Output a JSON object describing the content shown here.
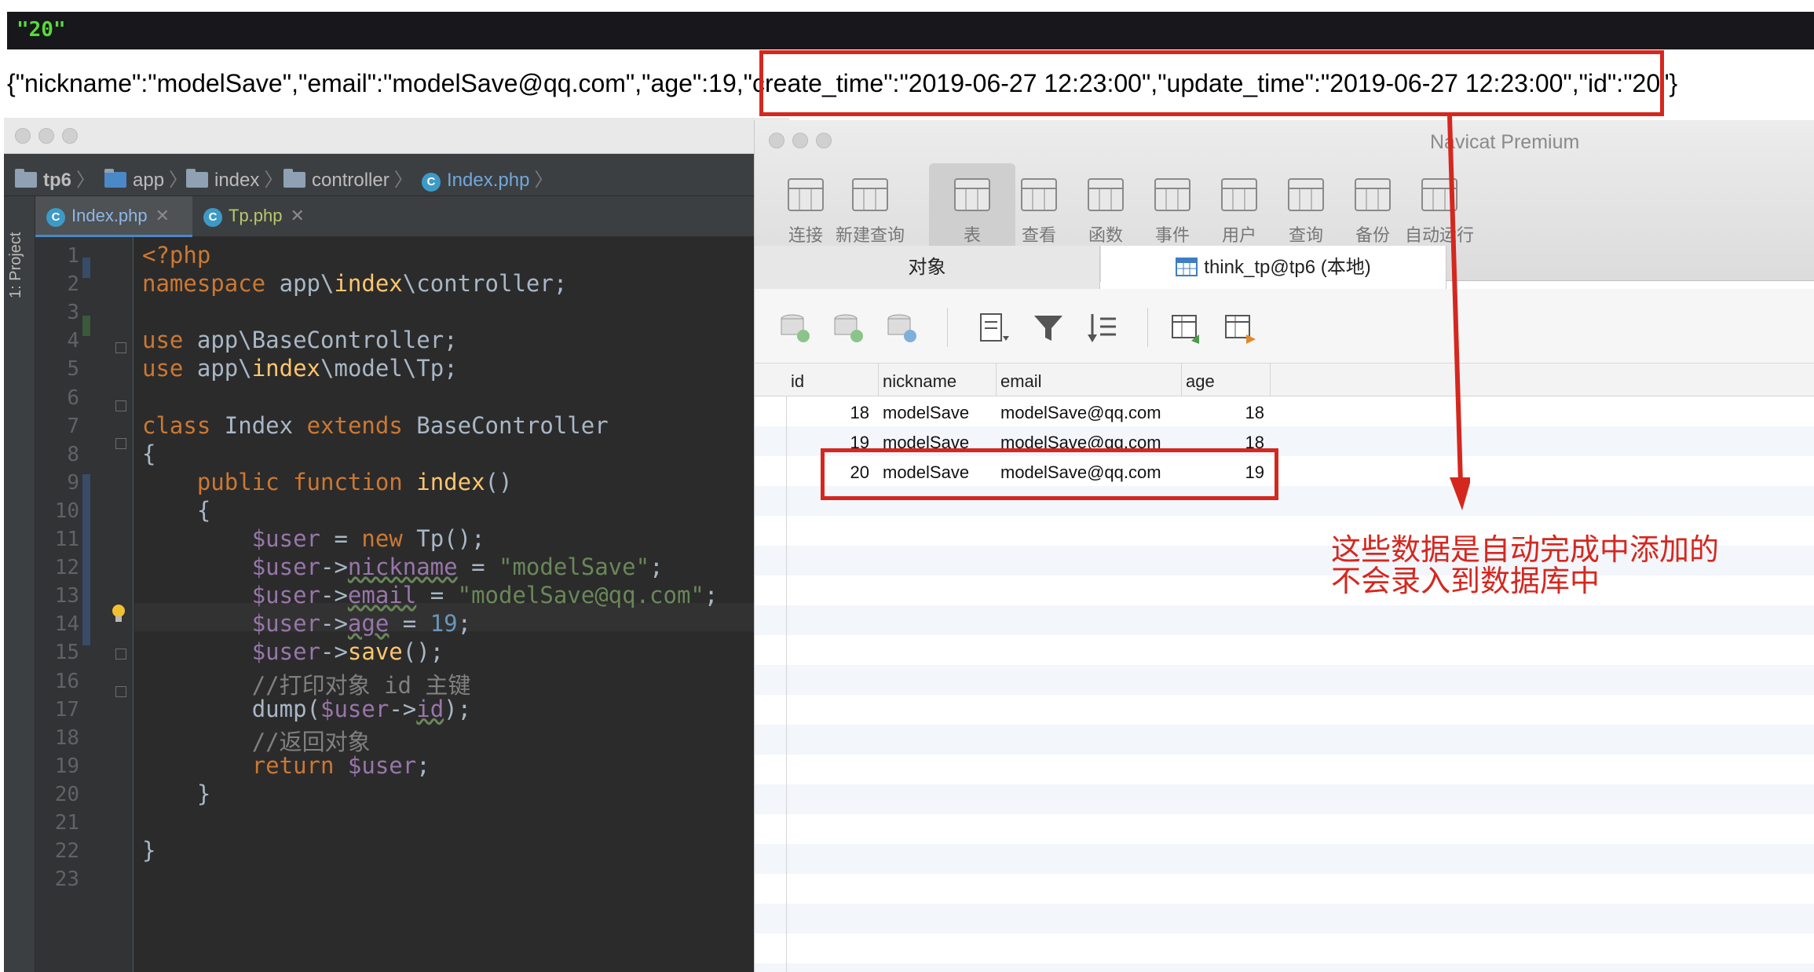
{
  "dump": {
    "value": "\"20\"",
    "json_line": "{\"nickname\":\"modelSave\",\"email\":\"modelSave@qq.com\",\"age\":19,\"create_time\":\"2019-06-27 12:23:00\",\"update_time\":\"2019-06-27 12:23:00\",\"id\":\"20\"}"
  },
  "ide": {
    "breadcrumb": [
      "tp6",
      "app",
      "index",
      "controller",
      "Index.php"
    ],
    "sidebar_label": "1: Project",
    "tabs": [
      {
        "label": "Index.php",
        "active": true
      },
      {
        "label": "Tp.php",
        "active": false
      }
    ],
    "line_numbers": [
      "1",
      "2",
      "3",
      "4",
      "5",
      "6",
      "7",
      "8",
      "9",
      "10",
      "11",
      "12",
      "13",
      "14",
      "15",
      "16",
      "17",
      "18",
      "19",
      "20",
      "21",
      "22",
      "23"
    ],
    "code_lines": [
      "<?php",
      "namespace app\\index\\controller;",
      "",
      "use app\\BaseController;",
      "use app\\index\\model\\Tp;",
      "",
      "class Index extends BaseController",
      "{",
      "    public function index()",
      "    {",
      "        $user = new Tp();",
      "        $user->nickname = \"modelSave\";",
      "        $user->email = \"modelSave@qq.com\";",
      "        $user->age = 19;",
      "        $user->save();",
      "        //打印对象 id 主键",
      "        dump($user->id);",
      "        //返回对象",
      "        return $user;",
      "    }",
      "",
      "}",
      ""
    ]
  },
  "navicat": {
    "title": "Navicat Premium",
    "toolbar": [
      {
        "label": "连接",
        "icon": "plug-icon"
      },
      {
        "label": "新建查询",
        "icon": "new-query-icon"
      },
      {
        "label": "表",
        "icon": "table-icon"
      },
      {
        "label": "查看",
        "icon": "view-icon"
      },
      {
        "label": "函数",
        "icon": "function-icon"
      },
      {
        "label": "事件",
        "icon": "clock-icon"
      },
      {
        "label": "用户",
        "icon": "user-icon"
      },
      {
        "label": "查询",
        "icon": "query-icon"
      },
      {
        "label": "备份",
        "icon": "backup-icon"
      },
      {
        "label": "自动运行",
        "icon": "schedule-icon"
      }
    ],
    "object_tab": "对象",
    "table_tab": "think_tp@tp6 (本地)",
    "columns": [
      "id",
      "nickname",
      "email",
      "age"
    ],
    "rows": [
      [
        "18",
        "modelSave",
        "modelSave@qq.com",
        "18"
      ],
      [
        "19",
        "modelSave",
        "modelSave@qq.com",
        "18"
      ],
      [
        "20",
        "modelSave",
        "modelSave@qq.com",
        "19"
      ]
    ]
  },
  "annotation": {
    "text_line1": "这些数据是自动完成中添加的",
    "text_line2": "不会录入到数据库中",
    "color": "#d4281f"
  }
}
